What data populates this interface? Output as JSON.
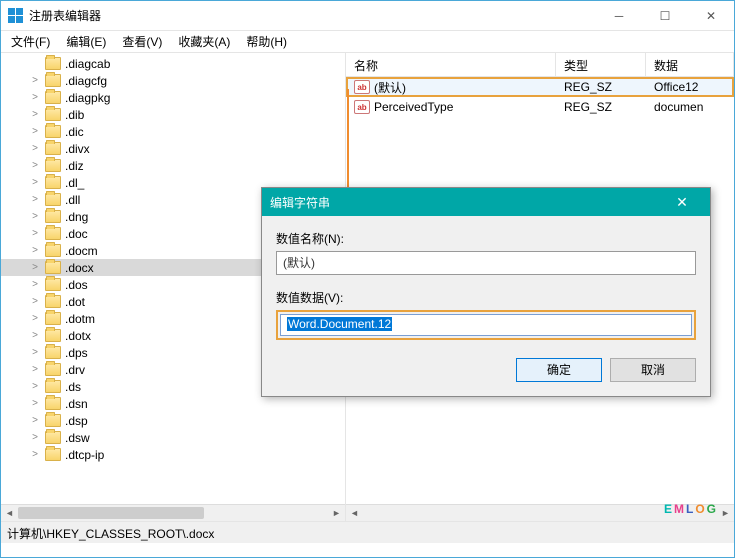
{
  "window": {
    "title": "注册表编辑器"
  },
  "menu": {
    "file": "文件(F)",
    "edit": "编辑(E)",
    "view": "查看(V)",
    "favorites": "收藏夹(A)",
    "help": "帮助(H)"
  },
  "tree": {
    "items": [
      {
        "name": ".diagcab",
        "expandable": false
      },
      {
        "name": ".diagcfg",
        "expandable": true
      },
      {
        "name": ".diagpkg",
        "expandable": true
      },
      {
        "name": ".dib",
        "expandable": true
      },
      {
        "name": ".dic",
        "expandable": true
      },
      {
        "name": ".divx",
        "expandable": true
      },
      {
        "name": ".diz",
        "expandable": true
      },
      {
        "name": ".dl_",
        "expandable": true
      },
      {
        "name": ".dll",
        "expandable": true
      },
      {
        "name": ".dng",
        "expandable": true
      },
      {
        "name": ".doc",
        "expandable": true
      },
      {
        "name": ".docm",
        "expandable": true
      },
      {
        "name": ".docx",
        "expandable": true,
        "selected": true
      },
      {
        "name": ".dos",
        "expandable": true
      },
      {
        "name": ".dot",
        "expandable": true
      },
      {
        "name": ".dotm",
        "expandable": true
      },
      {
        "name": ".dotx",
        "expandable": true
      },
      {
        "name": ".dps",
        "expandable": true
      },
      {
        "name": ".drv",
        "expandable": true
      },
      {
        "name": ".ds",
        "expandable": true
      },
      {
        "name": ".dsn",
        "expandable": true
      },
      {
        "name": ".dsp",
        "expandable": true
      },
      {
        "name": ".dsw",
        "expandable": true
      },
      {
        "name": ".dtcp-ip",
        "expandable": true
      }
    ]
  },
  "list": {
    "headers": {
      "name": "名称",
      "type": "类型",
      "data": "数据"
    },
    "rows": [
      {
        "name": "(默认)",
        "type": "REG_SZ",
        "data": "Office12",
        "highlighted": true
      },
      {
        "name": "PerceivedType",
        "type": "REG_SZ",
        "data": "documen"
      }
    ]
  },
  "dialog": {
    "title": "编辑字符串",
    "name_label": "数值名称(N):",
    "name_value": "(默认)",
    "data_label": "数值数据(V):",
    "data_value": "Word.Document.12",
    "ok": "确定",
    "cancel": "取消"
  },
  "statusbar": {
    "path": "计算机\\HKEY_CLASSES_ROOT\\.docx"
  },
  "watermark": {
    "text": "EMLOG"
  }
}
